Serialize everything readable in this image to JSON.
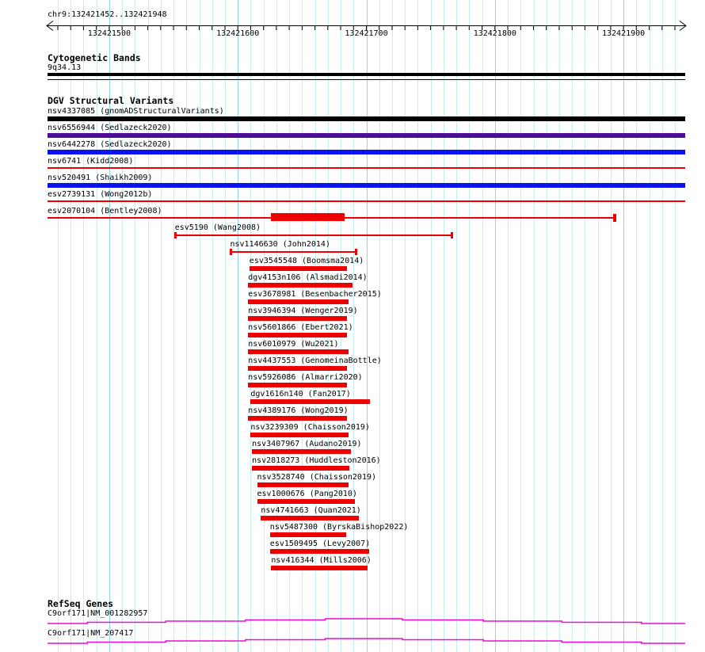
{
  "chart_data": {
    "type": "genome-tracks",
    "title": "chr9:132421452..132421948",
    "region": {
      "chromosome": "chr9",
      "start": 132421452,
      "end": 132421948
    },
    "axis": {
      "minor_tick_interval_bp": 10,
      "major_tick_labels": [
        "132421500",
        "132421600",
        "132421700",
        "132421800",
        "132421900"
      ]
    },
    "style": {
      "grid_minor_color": "#c7ecf5",
      "grid_major_color": "#90d5ea",
      "axis_color": "#000000",
      "gene_color": "#ea0dd6"
    },
    "cytoband": {
      "header": "Cytogenetic Bands",
      "band": "9q34.13"
    },
    "dgv": {
      "header": "DGV Structural Variants",
      "variants": [
        {
          "id": "nsv4337085",
          "study": "gnomADStructuralVariants",
          "glyph": "full-bar",
          "color": "#000000",
          "start": 132421452,
          "end": 132421948
        },
        {
          "id": "nsv6556944",
          "study": "Sedlazeck2020",
          "glyph": "full-bar",
          "color": "#4d0d95",
          "start": 132421452,
          "end": 132421948
        },
        {
          "id": "nsv6442278",
          "study": "Sedlazeck2020",
          "glyph": "full-bar",
          "color": "#0a12ee",
          "start": 132421452,
          "end": 132421948
        },
        {
          "id": "nsv6741",
          "study": "Kidd2008",
          "glyph": "full-line",
          "color": "#ee0000",
          "start": 132421452,
          "end": 132421948
        },
        {
          "id": "nsv520491",
          "study": "Shaikh2009",
          "glyph": "full-bar",
          "color": "#0a12ee",
          "start": 132421452,
          "end": 132421948
        },
        {
          "id": "esv2739131",
          "study": "Wong2012b",
          "glyph": "full-line",
          "color": "#ee0000",
          "start": 132421452,
          "end": 132421948
        },
        {
          "id": "esv2070104",
          "study": "Bentley2008",
          "glyph": "line-thick",
          "color": "#ee0000",
          "start": 132421452,
          "end": 132421893,
          "thick_start": 132421626,
          "thick_end": 132421683
        },
        {
          "id": "esv5190",
          "study": "Wang2008",
          "glyph": "range",
          "color": "#ee0000",
          "start": 132421551,
          "end": 132421767
        },
        {
          "id": "nsv1146630",
          "study": "John2014",
          "glyph": "range",
          "color": "#ee0000",
          "start": 132421594,
          "end": 132421692
        },
        {
          "id": "esv3545548",
          "study": "Boomsma2014",
          "glyph": "bar",
          "color": "#ee0000",
          "start": 132421609,
          "end": 132421685
        },
        {
          "id": "dgv4153n106",
          "study": "Alsmadi2014",
          "glyph": "bar",
          "color": "#ee0000",
          "start": 132421608,
          "end": 132421689
        },
        {
          "id": "esv3678981",
          "study": "Besenbacher2015",
          "glyph": "bar",
          "color": "#ee0000",
          "start": 132421608,
          "end": 132421686
        },
        {
          "id": "nsv3946394",
          "study": "Wenger2019",
          "glyph": "bar",
          "color": "#ee0000",
          "start": 132421608,
          "end": 132421685
        },
        {
          "id": "nsv5601866",
          "study": "Ebert2021",
          "glyph": "bar",
          "color": "#ee0000",
          "start": 132421608,
          "end": 132421685
        },
        {
          "id": "nsv6010979",
          "study": "Wu2021",
          "glyph": "bar",
          "color": "#ee0000",
          "start": 132421608,
          "end": 132421686
        },
        {
          "id": "nsv4437553",
          "study": "GenomeinaBottle",
          "glyph": "bar",
          "color": "#ee0000",
          "start": 132421608,
          "end": 132421685
        },
        {
          "id": "nsv5926086",
          "study": "Almarri2020",
          "glyph": "bar",
          "color": "#ee0000",
          "start": 132421608,
          "end": 132421685
        },
        {
          "id": "dgv1616n140",
          "study": "Fan2017",
          "glyph": "bar",
          "color": "#ee0000",
          "start": 132421610,
          "end": 132421703
        },
        {
          "id": "nsv4389176",
          "study": "Wong2019",
          "glyph": "bar",
          "color": "#ee0000",
          "start": 132421608,
          "end": 132421685
        },
        {
          "id": "nsv3239309",
          "study": "Chaisson2019",
          "glyph": "bar",
          "color": "#ee0000",
          "start": 132421610,
          "end": 132421686
        },
        {
          "id": "nsv3407967",
          "study": "Audano2019",
          "glyph": "bar",
          "color": "#ee0000",
          "start": 132421611,
          "end": 132421688
        },
        {
          "id": "nsv2818273",
          "study": "Huddleston2016",
          "glyph": "bar",
          "color": "#ee0000",
          "start": 132421611,
          "end": 132421687
        },
        {
          "id": "nsv3528740",
          "study": "Chaisson2019",
          "glyph": "bar",
          "color": "#ee0000",
          "start": 132421615,
          "end": 132421686
        },
        {
          "id": "esv1000676",
          "study": "Pang2010",
          "glyph": "bar",
          "color": "#ee0000",
          "start": 132421615,
          "end": 132421691
        },
        {
          "id": "nsv4741663",
          "study": "Quan2021",
          "glyph": "bar",
          "color": "#ee0000",
          "start": 132421618,
          "end": 132421694
        },
        {
          "id": "nsv5487300",
          "study": "ByrskaBishop2022",
          "glyph": "bar",
          "color": "#ee0000",
          "start": 132421625,
          "end": 132421684
        },
        {
          "id": "esv1509495",
          "study": "Levy2007",
          "glyph": "bar",
          "color": "#ee0000",
          "start": 132421625,
          "end": 132421702
        },
        {
          "id": "nsv416344",
          "study": "Mills2006",
          "glyph": "bar",
          "color": "#ee0000",
          "start": 132421626,
          "end": 132421701
        }
      ]
    },
    "refseq": {
      "header": "RefSeq Genes",
      "genes": [
        {
          "name": "C9orf171|NM_001282957",
          "break_bps": [
            132421452,
            132421483,
            132421544,
            132421606,
            132421668,
            132421728,
            132421791,
            132421852,
            132421914,
            132421948
          ],
          "levels": [
            4,
            3,
            2,
            1,
            0,
            1,
            2,
            3,
            4
          ]
        },
        {
          "name": "C9orf171|NM_207417",
          "break_bps": [
            132421452,
            132421483,
            132421544,
            132421606,
            132421668,
            132421728,
            132421791,
            132421852,
            132421914,
            132421948
          ],
          "levels": [
            4,
            3,
            2,
            1,
            0,
            1,
            2,
            3,
            4
          ]
        }
      ]
    }
  }
}
